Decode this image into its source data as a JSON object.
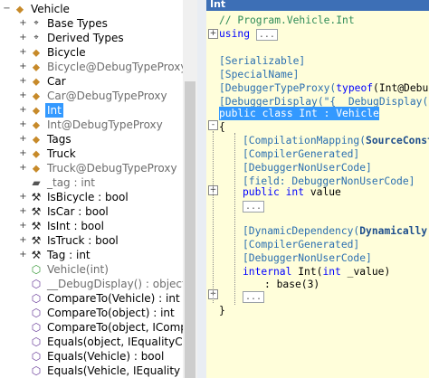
{
  "tree": {
    "items": [
      {
        "label": "Vehicle",
        "icon": "class-icon",
        "expander": "minus",
        "indent": 0,
        "gray": false
      },
      {
        "label": "Base Types",
        "icon": "base-types-icon",
        "expander": "plus",
        "indent": 1,
        "gray": false
      },
      {
        "label": "Derived Types",
        "icon": "derived-types-icon",
        "expander": "plus",
        "indent": 1,
        "gray": false
      },
      {
        "label": "Bicycle",
        "icon": "class-icon",
        "expander": "plus",
        "indent": 1,
        "gray": false
      },
      {
        "label": "Bicycle@DebugTypeProxy",
        "icon": "class-icon",
        "expander": "plus",
        "indent": 1,
        "gray": true
      },
      {
        "label": "Car",
        "icon": "class-icon",
        "expander": "plus",
        "indent": 1,
        "gray": false
      },
      {
        "label": "Car@DebugTypeProxy",
        "icon": "class-icon",
        "expander": "plus",
        "indent": 1,
        "gray": true
      },
      {
        "label": "Int",
        "icon": "class-icon",
        "expander": "plus",
        "indent": 1,
        "gray": false,
        "selected": true
      },
      {
        "label": "Int@DebugTypeProxy",
        "icon": "class-icon",
        "expander": "plus",
        "indent": 1,
        "gray": true
      },
      {
        "label": "Tags",
        "icon": "class-icon",
        "expander": "plus",
        "indent": 1,
        "gray": false
      },
      {
        "label": "Truck",
        "icon": "class-icon",
        "expander": "plus",
        "indent": 1,
        "gray": false
      },
      {
        "label": "Truck@DebugTypeProxy",
        "icon": "class-icon",
        "expander": "plus",
        "indent": 1,
        "gray": true
      },
      {
        "label": "_tag : int",
        "icon": "field-icon",
        "expander": "none",
        "indent": 1,
        "gray": true
      },
      {
        "label": "IsBicycle : bool",
        "icon": "property-icon",
        "expander": "plus",
        "indent": 1,
        "gray": false
      },
      {
        "label": "IsCar : bool",
        "icon": "property-icon",
        "expander": "plus",
        "indent": 1,
        "gray": false
      },
      {
        "label": "IsInt : bool",
        "icon": "property-icon",
        "expander": "plus",
        "indent": 1,
        "gray": false
      },
      {
        "label": "IsTruck : bool",
        "icon": "property-icon",
        "expander": "plus",
        "indent": 1,
        "gray": false
      },
      {
        "label": "Tag : int",
        "icon": "property-icon",
        "expander": "plus",
        "indent": 1,
        "gray": false
      },
      {
        "label": "Vehicle(int)",
        "icon": "constructor-icon",
        "expander": "none",
        "indent": 1,
        "gray": true
      },
      {
        "label": "__DebugDisplay() : object",
        "icon": "method-icon",
        "expander": "none",
        "indent": 1,
        "gray": true
      },
      {
        "label": "CompareTo(Vehicle) : int",
        "icon": "method-icon",
        "expander": "none",
        "indent": 1,
        "gray": false
      },
      {
        "label": "CompareTo(object) : int",
        "icon": "method-icon",
        "expander": "none",
        "indent": 1,
        "gray": false
      },
      {
        "label": "CompareTo(object, ICompare",
        "icon": "method-icon",
        "expander": "none",
        "indent": 1,
        "gray": false
      },
      {
        "label": "Equals(object, IEqualityComp",
        "icon": "method-icon",
        "expander": "none",
        "indent": 1,
        "gray": false
      },
      {
        "label": "Equals(Vehicle) : bool",
        "icon": "method-icon",
        "expander": "none",
        "indent": 1,
        "gray": false
      },
      {
        "label": "Equals(Vehicle, IEquality",
        "icon": "method-icon",
        "expander": "none",
        "indent": 1,
        "gray": false
      }
    ]
  },
  "code_tab": {
    "title": "Int"
  },
  "code": {
    "comment": "// Program.Vehicle.Int",
    "using_kw": "using",
    "ellipsis": "...",
    "attr_serializable": "[Serializable]",
    "attr_specialname": "[SpecialName]",
    "attr_typeproxy_a": "[DebuggerTypeProxy(",
    "attr_typeproxy_kw": "typeof",
    "attr_typeproxy_b": "(Int@Debug",
    "attr_display_a": "[DebuggerDisplay(\"{__DebugDisplay(",
    "class_decl": "public class Int : Vehicle",
    "open_brace": "{",
    "attr_compmap_a": "[CompilationMapping(",
    "attr_compmap_b": "SourceConst",
    "attr_compgen": "[CompilerGenerated]",
    "attr_nonuser": "[DebuggerNonUserCode]",
    "attr_field": "[field: DebuggerNonUserCode]",
    "prop_public": "public",
    "prop_int": "int",
    "prop_name": "value",
    "attr_dyndep_a": "[DynamicDependency(",
    "attr_dyndep_b": "Dynamically",
    "attr_compgen2": "[CompilerGenerated]",
    "attr_nonuser2": "[DebuggerNonUserCode]",
    "ctor_internal": "internal",
    "ctor_name": "Int(",
    "ctor_int": "int",
    "ctor_param": "_value)",
    "base_call": ": base(3)",
    "close_brace": "}"
  },
  "colors": {
    "selection": "#3399ff",
    "code_bg": "#fffeda",
    "tab_bg": "#3d6fb6",
    "keyword": "#0000ff",
    "comment": "#2e8b57"
  }
}
